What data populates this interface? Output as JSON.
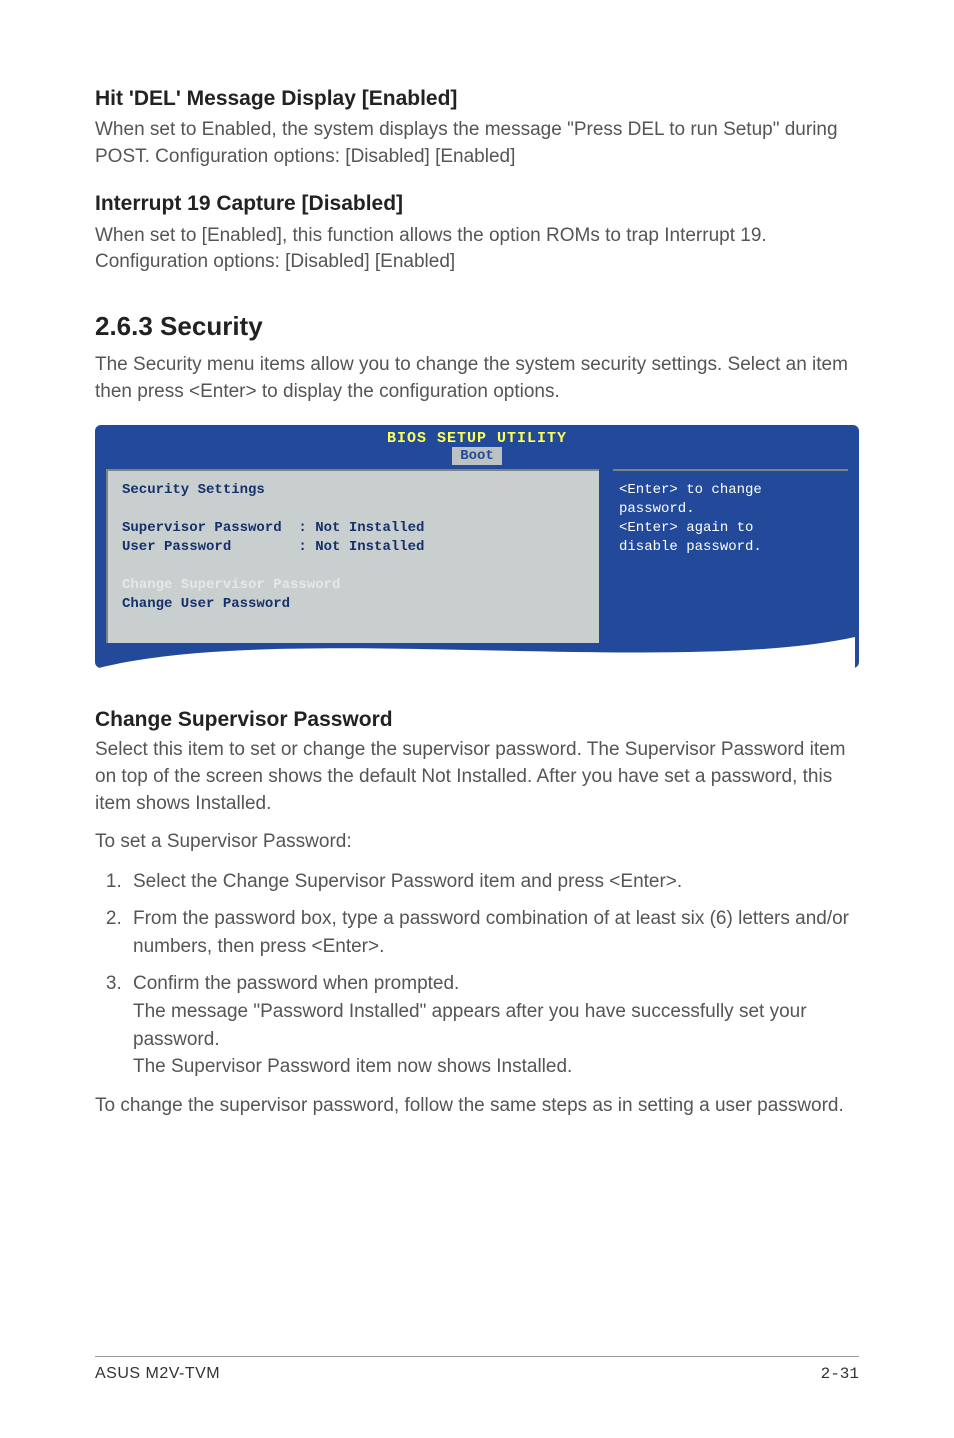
{
  "s1": {
    "title": "Hit 'DEL' Message Display [Enabled]",
    "body": "When set to Enabled, the system displays the message \"Press DEL to run Setup\" during POST. Configuration options: [Disabled] [Enabled]"
  },
  "s2": {
    "title": "Interrupt 19 Capture [Disabled]",
    "body": "When set to [Enabled], this function allows the option ROMs to trap Interrupt 19. Configuration options: [Disabled] [Enabled]"
  },
  "sec": {
    "heading": "2.6.3   Security",
    "intro": "The Security menu items allow you to change the system security settings. Select an item then press <Enter> to display the configuration options."
  },
  "bios": {
    "header": "BIOS SETUP UTILITY",
    "tab": "Boot",
    "left_line1": "Security Settings",
    "left_line2": "Supervisor Password  : Not Installed",
    "left_line3": "User Password        : Not Installed",
    "left_line4": "Change Supervisor Password",
    "left_line5": "Change User Password",
    "right_line1": "<Enter> to change",
    "right_line2": "password.",
    "right_line3": "<Enter> again to",
    "right_line4": "disable password."
  },
  "csp": {
    "title": "Change Supervisor Password",
    "p1": "Select this item to set or change the supervisor password. The Supervisor Password item on top of the screen shows the default Not Installed. After you have set a password, this item shows Installed.",
    "p2": "To set a Supervisor Password:",
    "step1": "Select the Change Supervisor Password item and press <Enter>.",
    "step2": "From the password box, type a password combination of at least six (6) letters and/or numbers, then press <Enter>.",
    "step3a": "Confirm the password when prompted.",
    "step3b": "The message \"Password Installed\" appears after you have successfully set your password.",
    "step3c": "The Supervisor Password item now shows Installed.",
    "p3": "To change the supervisor password, follow the same steps as in setting a user password."
  },
  "footer": {
    "left": "ASUS M2V-TVM",
    "right": "2-31"
  }
}
